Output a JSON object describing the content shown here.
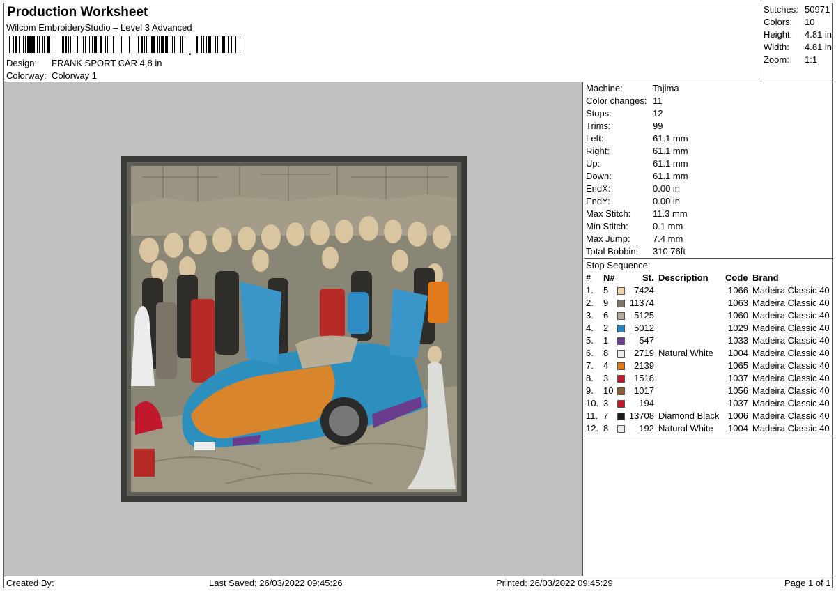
{
  "header": {
    "title": "Production Worksheet",
    "subtitle": "Wilcom EmbroideryStudio – Level 3 Advanced",
    "design_label": "Design:",
    "design_value": "FRANK SPORT CAR 4,8 in",
    "colorway_label": "Colorway:",
    "colorway_value": "Colorway 1"
  },
  "summary": [
    {
      "k": "Stitches:",
      "v": "50971"
    },
    {
      "k": "Colors:",
      "v": "10"
    },
    {
      "k": "Height:",
      "v": "4.81 in"
    },
    {
      "k": "Width:",
      "v": "4.81 in"
    },
    {
      "k": "Zoom:",
      "v": "1:1"
    }
  ],
  "details": [
    {
      "k": "Machine:",
      "v": "Tajima"
    },
    {
      "k": "Color changes:",
      "v": "11"
    },
    {
      "k": "Stops:",
      "v": "12"
    },
    {
      "k": "Trims:",
      "v": "99"
    },
    {
      "k": "Left:",
      "v": "61.1 mm"
    },
    {
      "k": "Right:",
      "v": "61.1 mm"
    },
    {
      "k": "Up:",
      "v": "61.1 mm"
    },
    {
      "k": "Down:",
      "v": "61.1 mm"
    },
    {
      "k": "EndX:",
      "v": "0.00 in"
    },
    {
      "k": "EndY:",
      "v": "0.00 in"
    },
    {
      "k": "Max Stitch:",
      "v": "11.3 mm"
    },
    {
      "k": "Min Stitch:",
      "v": "0.1 mm"
    },
    {
      "k": "Max Jump:",
      "v": "7.4 mm"
    },
    {
      "k": "Total Bobbin:",
      "v": "310.76ft"
    }
  ],
  "stop_sequence": {
    "title": "Stop Sequence:",
    "headers": {
      "hash": "#",
      "n": "N#",
      "st": "St.",
      "desc": "Description",
      "code": "Code",
      "brand": "Brand"
    },
    "rows": [
      {
        "i": "1.",
        "n": "5",
        "color": "#f0d3a8",
        "st": "7424",
        "desc": "",
        "code": "1066",
        "brand": "Madeira Classic 40"
      },
      {
        "i": "2.",
        "n": "9",
        "color": "#7c7668",
        "st": "11374",
        "desc": "",
        "code": "1063",
        "brand": "Madeira Classic 40"
      },
      {
        "i": "3.",
        "n": "6",
        "color": "#b4a898",
        "st": "5125",
        "desc": "",
        "code": "1060",
        "brand": "Madeira Classic 40"
      },
      {
        "i": "4.",
        "n": "2",
        "color": "#2a86c0",
        "st": "5012",
        "desc": "",
        "code": "1029",
        "brand": "Madeira Classic 40"
      },
      {
        "i": "5.",
        "n": "1",
        "color": "#6a3c8e",
        "st": "547",
        "desc": "",
        "code": "1033",
        "brand": "Madeira Classic 40"
      },
      {
        "i": "6.",
        "n": "8",
        "color": "#ececec",
        "st": "2719",
        "desc": "Natural White",
        "code": "1004",
        "brand": "Madeira Classic 40"
      },
      {
        "i": "7.",
        "n": "4",
        "color": "#e07a1c",
        "st": "2139",
        "desc": "",
        "code": "1065",
        "brand": "Madeira Classic 40"
      },
      {
        "i": "8.",
        "n": "3",
        "color": "#c0182c",
        "st": "1518",
        "desc": "",
        "code": "1037",
        "brand": "Madeira Classic 40"
      },
      {
        "i": "9.",
        "n": "10",
        "color": "#8c5c34",
        "st": "1017",
        "desc": "",
        "code": "1056",
        "brand": "Madeira Classic 40"
      },
      {
        "i": "10.",
        "n": "3",
        "color": "#c0182c",
        "st": "194",
        "desc": "",
        "code": "1037",
        "brand": "Madeira Classic 40"
      },
      {
        "i": "11.",
        "n": "7",
        "color": "#1e1e1e",
        "st": "13708",
        "desc": "Diamond Black",
        "code": "1006",
        "brand": "Madeira Classic 40"
      },
      {
        "i": "12.",
        "n": "8",
        "color": "#ececec",
        "st": "192",
        "desc": "Natural White",
        "code": "1004",
        "brand": "Madeira Classic 40"
      }
    ]
  },
  "footer": {
    "created_by": "Created By:",
    "last_saved": "Last Saved: 26/03/2022 09:45:26",
    "printed": "Printed: 26/03/2022 09:45:29",
    "page": "Page 1 of 1"
  }
}
